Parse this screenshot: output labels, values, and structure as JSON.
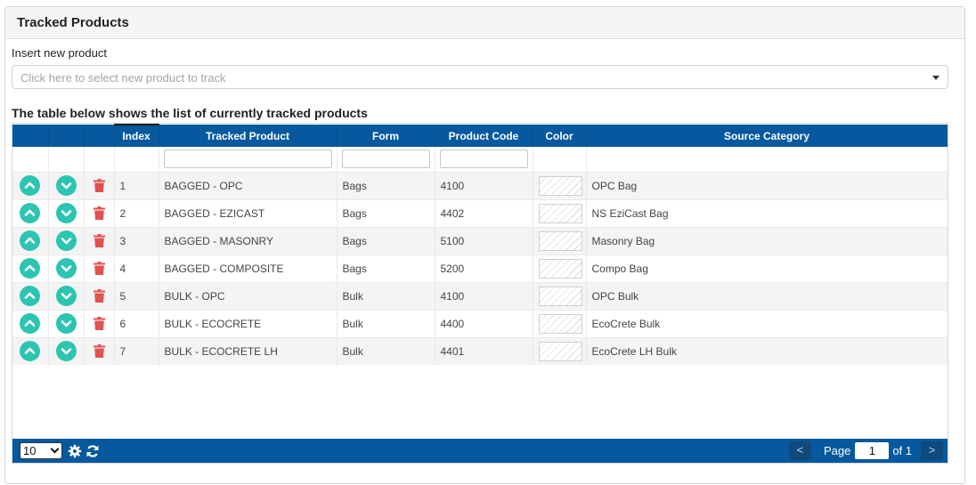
{
  "panel": {
    "title": "Tracked Products"
  },
  "insert": {
    "label": "Insert new product",
    "placeholder": "Click here to select new product to track"
  },
  "table": {
    "caption": "The table below shows the list of currently tracked products",
    "headers": {
      "index": "Index",
      "tracked_product": "Tracked Product",
      "form": "Form",
      "product_code": "Product Code",
      "color": "Color",
      "source_category": "Source Category"
    },
    "rows": [
      {
        "index": "1",
        "product": "BAGGED - OPC",
        "form": "Bags",
        "code": "4100",
        "category": "OPC Bag"
      },
      {
        "index": "2",
        "product": "BAGGED - EZICAST",
        "form": "Bags",
        "code": "4402",
        "category": "NS EziCast Bag"
      },
      {
        "index": "3",
        "product": "BAGGED - MASONRY",
        "form": "Bags",
        "code": "5100",
        "category": "Masonry Bag"
      },
      {
        "index": "4",
        "product": "BAGGED - COMPOSITE",
        "form": "Bags",
        "code": "5200",
        "category": "Compo Bag"
      },
      {
        "index": "5",
        "product": "BULK - OPC",
        "form": "Bulk",
        "code": "4100",
        "category": "OPC Bulk"
      },
      {
        "index": "6",
        "product": "BULK - ECOCRETE",
        "form": "Bulk",
        "code": "4400",
        "category": "EcoCrete Bulk"
      },
      {
        "index": "7",
        "product": "BULK - ECOCRETE LH",
        "form": "Bulk",
        "code": "4401",
        "category": "EcoCrete LH Bulk"
      }
    ]
  },
  "footer": {
    "page_size": "10",
    "prev": "<",
    "next": ">",
    "page_label": "Page",
    "page_value": "1",
    "of_label": "of 1"
  },
  "colors": {
    "header_blue": "#06599e",
    "move_button": "#2cc5b2",
    "delete_icon": "#e0524f"
  },
  "icons": {
    "move_up": "chevron-up-icon",
    "move_down": "chevron-down-icon",
    "delete": "trash-icon",
    "settings": "gear-icon",
    "refresh": "refresh-icon"
  }
}
